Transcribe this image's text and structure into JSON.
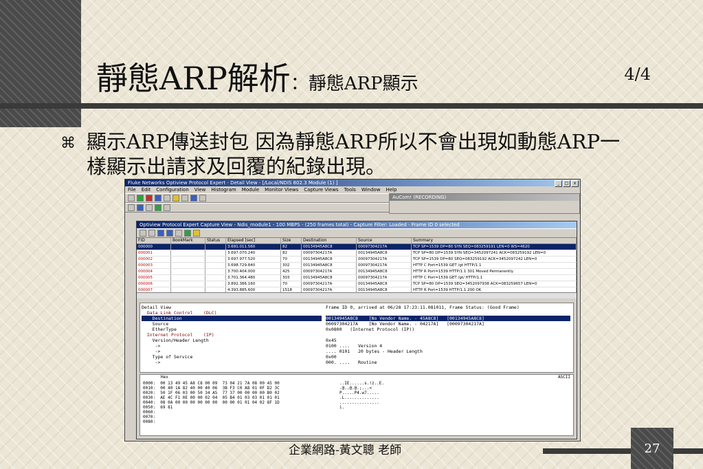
{
  "slide": {
    "title": "靜態ARP解析",
    "subtitle": "：靜態ARP顯示",
    "page_fraction": "4/4",
    "bullet": "顯示ARP傳送封包 因為靜態ARP所以不會出現如動態ARP一樣顯示出請求及回覆的紀錄出現。",
    "footer": "企業網路-黃文聰 老師",
    "page_number": "27"
  },
  "app": {
    "title": "Fluke Networks Optiview Protocol Expert - Detail View - [/Local/NDIS 802.3 Module (1) ]",
    "menu": [
      "File",
      "Edit",
      "Configuration",
      "View",
      "Histogram",
      "Module",
      "Monitor Views",
      "Capture Views",
      "Tools",
      "Window",
      "Help"
    ],
    "subwindow_title": "AuCom! (RECORDING)",
    "capture_window_title": "Optiview Protocol Expert Capture View - Ndis_module1 - 100 MBPS - (250 frames total) - Capture Filter: Loaded - Frame ID 0 selected",
    "columns": [
      "FID",
      "BookMark",
      "Status",
      "Elapsed [sec]",
      "Size",
      "Destination",
      "Source",
      "Summary"
    ],
    "rows": [
      [
        "000000",
        "",
        "",
        "3.691.011.560",
        "82",
        "00134945A8C8",
        "00097304217A",
        "TCP  SP=1539 DP=80 SYN SEQ=083259191 LEN=0 WS=4620"
      ],
      [
        "000001",
        "",
        "",
        "3.697.070.240",
        "82",
        "00097304217A",
        "00134945A8C8",
        "TCP  SP=80 DP=1539 SYN SEQ=3452097241 ACK=083259192 LEN=0"
      ],
      [
        "000002",
        "",
        "",
        "3.697.977.520",
        "70",
        "00134945A8C8",
        "00097304217A",
        "TCP  SP=1539 DP=80 SEQ=083259192 ACK=3452097242 LEN=0"
      ],
      [
        "000003",
        "",
        "",
        "3.698.729.840",
        "302",
        "00134945A8C8",
        "00097304217A",
        "HTTP  C Port=1539 GET /gt HTTP/1.1"
      ],
      [
        "000004",
        "",
        "",
        "3.700.404.000",
        "425",
        "00097304217A",
        "00134945A8C8",
        "HTTP  R Port=1539 HTTP/1.1 301 Moved Permanently"
      ],
      [
        "000005",
        "",
        "",
        "3.701.364.480",
        "303",
        "00134945A8C8",
        "00097304217A",
        "HTTP  C Port=1539 GET /gt/ HTTP/1.1"
      ],
      [
        "000006",
        "",
        "",
        "3.892.386.160",
        "70",
        "00097304217A",
        "00134945A8C8",
        "TCP  SP=80 DP=1539 SEQ=3452097938 ACK=083259657 LEN=0"
      ],
      [
        "000007",
        "",
        "",
        "4.393.885.600",
        "1518",
        "00097304217A",
        "00134945A8C8",
        "HTTP  R Port=1539 HTTP/1.1 200 OK"
      ],
      [
        "000008",
        "",
        "",
        "4.393.965.400",
        "1518",
        "00097304217A",
        "00134945A8C8",
        "HTTP  R Port=1539 Data"
      ]
    ],
    "detail_left": [
      "Detail View",
      "  Data Link Control    (DLC)",
      "    Destination",
      "    Source",
      "    EtherType",
      "  Internet Protocol    (IP)",
      "    Version/Header Length",
      "     ->",
      "     ->",
      "    Type of Service",
      "     ->"
    ],
    "detail_right": [
      "Frame ID 0, arrived at 06/28 17:23:11.081011, Frame Status: (Good Frame)",
      "",
      "00134945A8C8    [No Vendor Name. - 45A8C8]   [00134945A8C8]",
      "00097304217A    [No Vendor Name. - 04217A]   [00097304217A]",
      "0x0800   (Internet Protocol (IP))",
      "",
      "0x45",
      "0100 ....   Version 4",
      ".... 0101   20 bytes - Header Length",
      "0x00",
      "000. ....   Routine"
    ],
    "hex_label": "Hex",
    "ascii_label": "ASCII",
    "hex_lines": [
      "0000:  00 13 49 45 A8 C8 00 09  73 04 21 7A 08 00 45 00",
      "0010:  00 40 1A 82 40 00 40 06  3B F3 C0 A8 01 0F D2 3C",
      "0020:  50 1F 06 03 00 50 34 A5  77 37 00 00 00 00 B0 02",
      "0030:  AE 4C F1 0E 00 00 02 04  05 B4 01 03 03 01 01 01",
      "0040:  08 0A 00 00 00 00 00 00  00 00 01 01 04 02 8F 1D",
      "0050:  69 81",
      "0060:",
      "0070:",
      "0080:"
    ],
    "ascii_lines": [
      "..IE......s.!z..E.",
      ".@..@.@.;...<",
      "P.....P4.w7.....",
      ".L..............",
      "................",
      "i."
    ]
  }
}
